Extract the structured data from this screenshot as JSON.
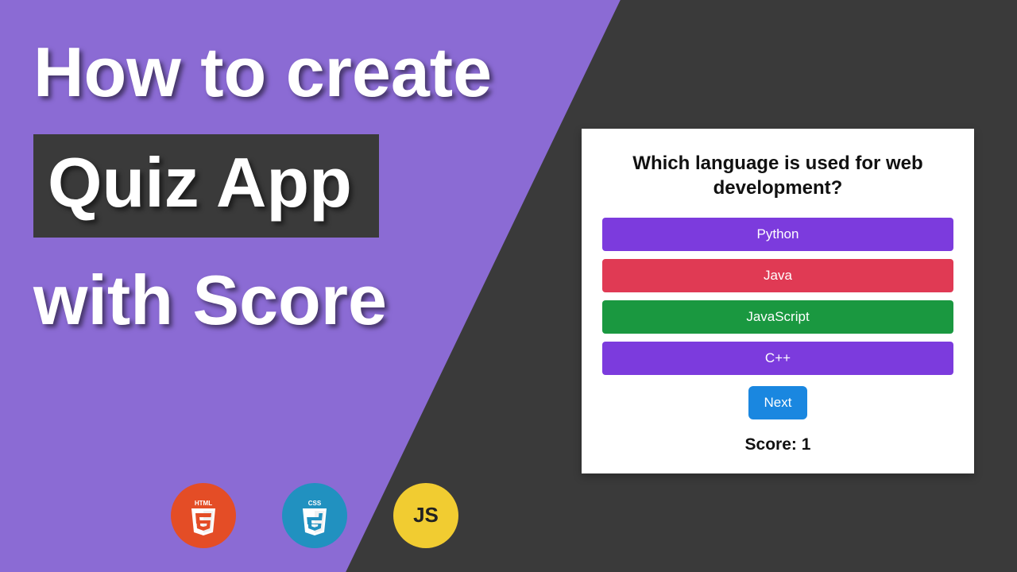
{
  "headline": {
    "line1": "How to create",
    "line2": "Quiz App",
    "line3": "with Score"
  },
  "badges": {
    "html": "HTML",
    "css": "CSS",
    "js": "JS"
  },
  "quiz": {
    "question": "Which language is used for web development?",
    "options": [
      {
        "label": "Python",
        "state": "purple"
      },
      {
        "label": "Java",
        "state": "red"
      },
      {
        "label": "JavaScript",
        "state": "green"
      },
      {
        "label": "C++",
        "state": "purple"
      }
    ],
    "next_label": "Next",
    "score_prefix": "Score: ",
    "score_value": "1"
  }
}
